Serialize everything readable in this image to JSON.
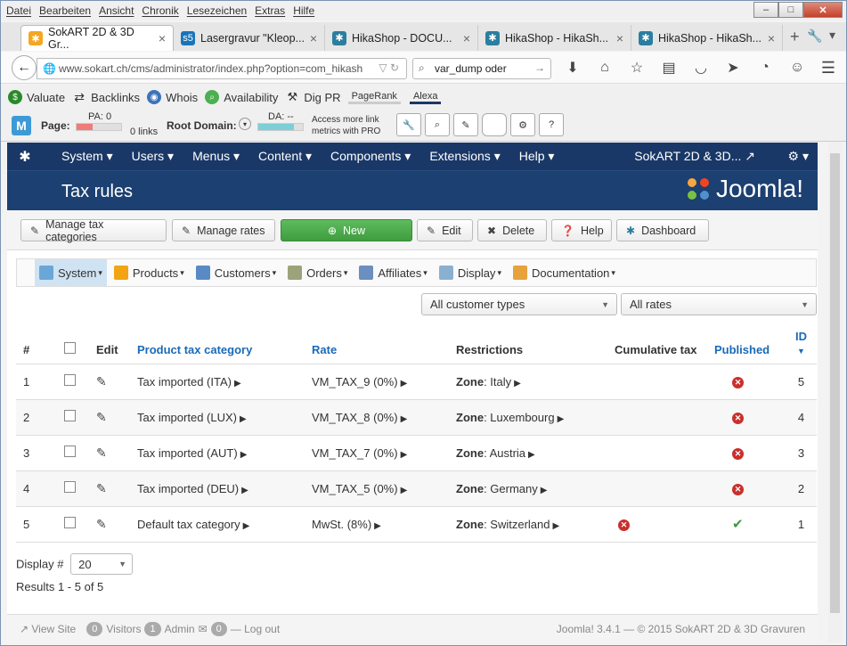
{
  "menubar": [
    "Datei",
    "Bearbeiten",
    "Ansicht",
    "Chronik",
    "Lesezeichen",
    "Extras",
    "Hilfe"
  ],
  "tabs": [
    {
      "label": "SokART 2D & 3D Gr...",
      "icon": "joomla-icon",
      "color": "#f5a623"
    },
    {
      "label": "Lasergravur \"Kleop...",
      "icon": "s5-icon",
      "color": "#1a74b8"
    },
    {
      "label": "HikaShop - DOCU...",
      "icon": "hikashop-icon",
      "color": "#2a7fa0"
    },
    {
      "label": "HikaShop - HikaSh...",
      "icon": "hikashop-icon",
      "color": "#2a7fa0"
    },
    {
      "label": "HikaShop - HikaSh...",
      "icon": "hikashop-icon",
      "color": "#2a7fa0"
    }
  ],
  "nav": {
    "url": "www.sokart.ch/cms/administrator/index.php?option=com_hikash",
    "search": "var_dump oder"
  },
  "seobar": {
    "items": [
      "Valuate",
      "Backlinks",
      "Whois",
      "Availability",
      "Dig PR"
    ],
    "pagerank": "PageRank",
    "alexa": "Alexa"
  },
  "mozbar": {
    "page": "Page:",
    "pa": "PA: 0",
    "links": "0 links",
    "root": "Root Domain:",
    "da": "DA: --",
    "pro": "Access more link metrics with PRO"
  },
  "joomla": {
    "menu": [
      "System",
      "Users",
      "Menus",
      "Content",
      "Components",
      "Extensions",
      "Help"
    ],
    "site": "SokART 2D & 3D...",
    "title": "Tax rules",
    "brand": "Joomla!"
  },
  "toolbar": {
    "manage_categories": "Manage tax categories",
    "manage_rates": "Manage rates",
    "new": "New",
    "edit": "Edit",
    "delete": "Delete",
    "help": "Help",
    "dashboard": "Dashboard"
  },
  "hikamenu": [
    "System",
    "Products",
    "Customers",
    "Orders",
    "Affiliates",
    "Display",
    "Documentation"
  ],
  "filters": {
    "customer_types": "All customer types",
    "rates": "All rates"
  },
  "table": {
    "headers": {
      "num": "#",
      "edit": "Edit",
      "category": "Product tax category",
      "rate": "Rate",
      "restrictions": "Restrictions",
      "cumulative": "Cumulative tax",
      "published": "Published",
      "id": "ID"
    },
    "rows": [
      {
        "num": "1",
        "category": "Tax imported (ITA)",
        "rate": "VM_TAX_9 (0%)",
        "zone_label": "Zone",
        "zone": "Italy",
        "cumulative": "",
        "published": "no",
        "id": "5"
      },
      {
        "num": "2",
        "category": "Tax imported (LUX)",
        "rate": "VM_TAX_8 (0%)",
        "zone_label": "Zone",
        "zone": "Luxembourg",
        "cumulative": "",
        "published": "no",
        "id": "4"
      },
      {
        "num": "3",
        "category": "Tax imported (AUT)",
        "rate": "VM_TAX_7 (0%)",
        "zone_label": "Zone",
        "zone": "Austria",
        "cumulative": "",
        "published": "no",
        "id": "3"
      },
      {
        "num": "4",
        "category": "Tax imported (DEU)",
        "rate": "VM_TAX_5 (0%)",
        "zone_label": "Zone",
        "zone": "Germany",
        "cumulative": "",
        "published": "no",
        "id": "2"
      },
      {
        "num": "5",
        "category": "Default tax category",
        "rate": "MwSt. (8%)",
        "zone_label": "Zone",
        "zone": "Switzerland",
        "cumulative": "no",
        "published": "yes",
        "id": "1"
      }
    ]
  },
  "pagination": {
    "display_label": "Display #",
    "display_value": "20",
    "results": "Results 1 - 5 of 5"
  },
  "status": {
    "view_site": "View Site",
    "visitors_count": "0",
    "visitors": "Visitors",
    "admin_count": "1",
    "admin": "Admin",
    "msg_count": "0",
    "logout": "Log out",
    "copyright": "Joomla! 3.4.1  —  © 2015 SokART 2D & 3D Gravuren"
  }
}
